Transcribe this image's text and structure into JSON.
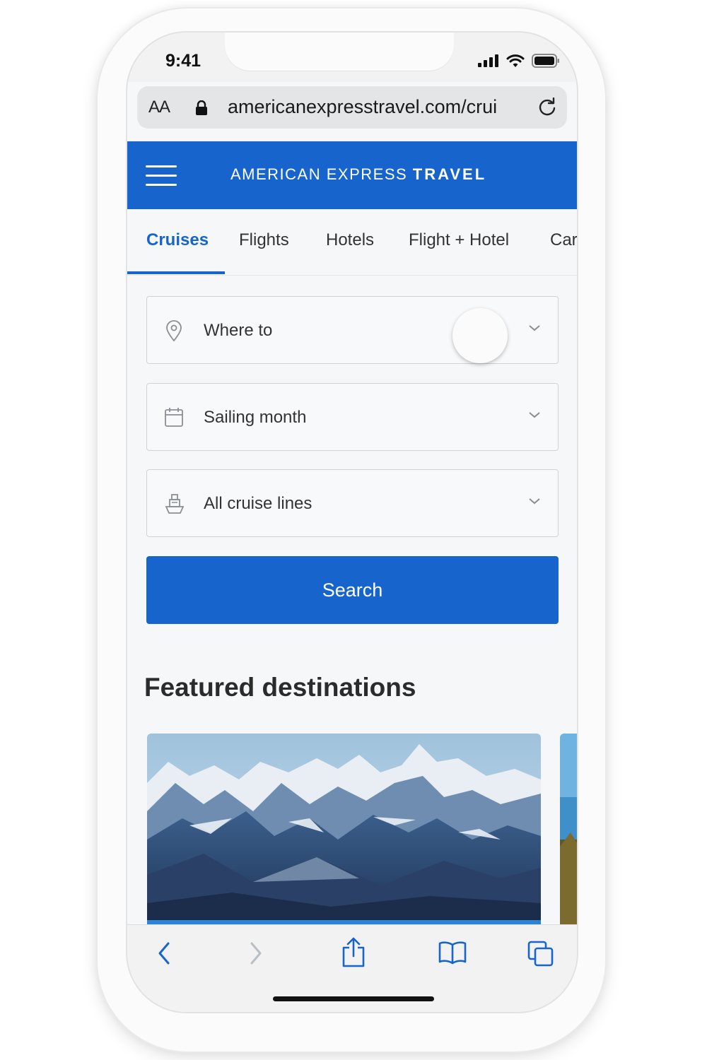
{
  "status_bar": {
    "time": "9:41"
  },
  "browser": {
    "text_size_label": "AA",
    "url": "americanexpresstravel.com/crui"
  },
  "header": {
    "brand_regular": "AMERICAN EXPRESS",
    "brand_bold": "TRAVEL"
  },
  "tabs": [
    {
      "label": "Cruises",
      "active": true
    },
    {
      "label": "Flights",
      "active": false
    },
    {
      "label": "Hotels",
      "active": false
    },
    {
      "label": "Flight + Hotel",
      "active": false
    },
    {
      "label": "Car",
      "active": false
    }
  ],
  "search_form": {
    "destination": {
      "label": "Where to",
      "icon": "location-pin-icon"
    },
    "sailing_month": {
      "label": "Sailing month",
      "icon": "calendar-icon"
    },
    "cruise_line": {
      "label": "All cruise lines",
      "icon": "ship-icon"
    },
    "search_label": "Search"
  },
  "featured": {
    "title": "Featured destinations"
  },
  "colors": {
    "brand_blue": "#1765cc",
    "background": "#f6f7f8"
  },
  "toolbar_icons": [
    "back-icon",
    "forward-icon",
    "share-icon",
    "bookmarks-icon",
    "tabs-icon"
  ]
}
